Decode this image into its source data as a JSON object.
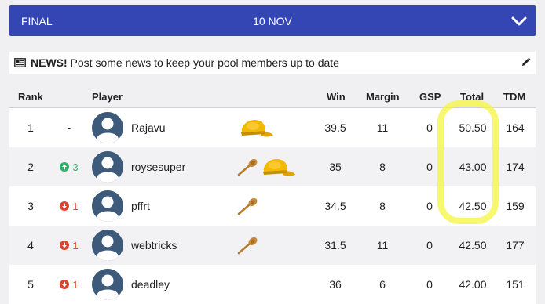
{
  "banner": {
    "status": "FINAL",
    "date": "10 NOV"
  },
  "news": {
    "bold": "NEWS!",
    "text": " Post some news to keep your pool members up to date"
  },
  "table": {
    "headers": {
      "rank": "Rank",
      "player": "Player",
      "win": "Win",
      "margin": "Margin",
      "gsp": "GSP",
      "total": "Total",
      "tdm": "TDM"
    },
    "rows": [
      {
        "rank": "1",
        "move": "-",
        "move_dir": "none",
        "player": "Rajavu",
        "awards": [
          "cap"
        ],
        "win": "39.5",
        "margin": "11",
        "gsp": "0",
        "total": "50.50",
        "tdm": "164"
      },
      {
        "rank": "2",
        "move": "3",
        "move_dir": "up",
        "player": "roysesuper",
        "awards": [
          "spoon",
          "cap"
        ],
        "win": "35",
        "margin": "8",
        "gsp": "0",
        "total": "43.00",
        "tdm": "174"
      },
      {
        "rank": "3",
        "move": "1",
        "move_dir": "down",
        "player": "pffrt",
        "awards": [
          "spoon"
        ],
        "win": "34.5",
        "margin": "8",
        "gsp": "0",
        "total": "42.50",
        "tdm": "159"
      },
      {
        "rank": "4",
        "move": "1",
        "move_dir": "down",
        "player": "webtricks",
        "awards": [
          "spoon"
        ],
        "win": "31.5",
        "margin": "11",
        "gsp": "0",
        "total": "42.50",
        "tdm": "177"
      },
      {
        "rank": "5",
        "move": "1",
        "move_dir": "down",
        "player": "deadley",
        "awards": [],
        "win": "36",
        "margin": "6",
        "gsp": "0",
        "total": "42.00",
        "tdm": "151"
      }
    ]
  },
  "colors": {
    "banner": "#3445b4",
    "up": "#2db36a",
    "down": "#d9442c",
    "highlight": "#f6f646"
  }
}
